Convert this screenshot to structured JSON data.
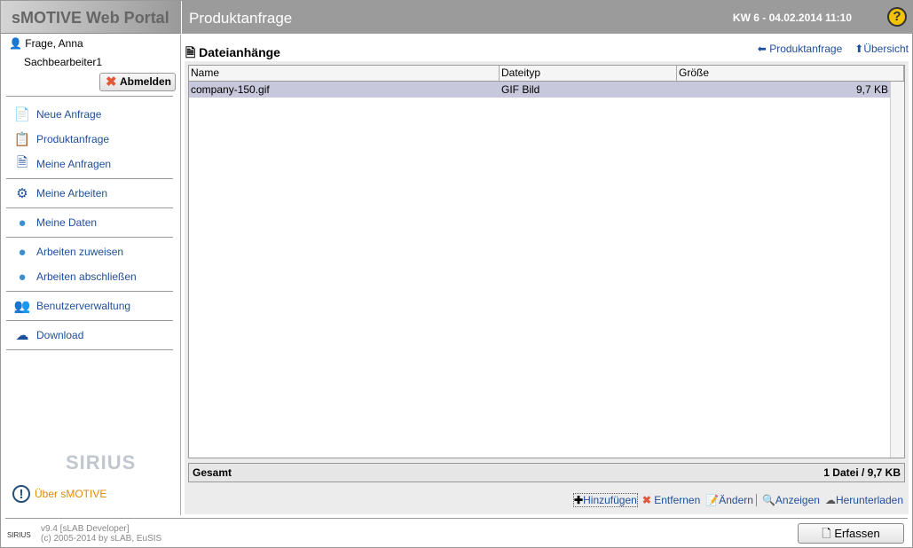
{
  "app": {
    "title": "sMOTIVE Web Portal",
    "page_title": "Produktanfrage",
    "date": "KW 6 - 04.02.2014 11:10"
  },
  "user": {
    "name": "Frage, Anna",
    "role": "Sachbearbeiter1",
    "logout": "Abmelden"
  },
  "nav": [
    {
      "label": "Neue Anfrage",
      "icon": "new-document-icon"
    },
    {
      "label": "Produktanfrage",
      "icon": "product-request-icon"
    },
    {
      "label": "Meine Anfragen",
      "icon": "my-requests-icon"
    },
    {
      "label": "Meine Arbeiten",
      "icon": "gears-icon"
    },
    {
      "label": "Meine Daten",
      "icon": "user-icon"
    },
    {
      "label": "Arbeiten zuweisen",
      "icon": "worker-icon"
    },
    {
      "label": "Arbeiten abschließen",
      "icon": "worker-done-icon"
    },
    {
      "label": "Benutzerverwaltung",
      "icon": "users-icon"
    },
    {
      "label": "Download",
      "icon": "cloud-download-icon"
    }
  ],
  "logo": "SIRIUS",
  "about": "Über sMOTIVE",
  "main": {
    "title": "Dateianhänge",
    "link_back": "Produktanfrage",
    "link_overview": "Übersicht",
    "columns": [
      "Name",
      "Dateityp",
      "Größe"
    ],
    "rows": [
      {
        "name": "company-150.gif",
        "type": "GIF Bild",
        "size": "9,7 KB"
      }
    ],
    "total_label": "Gesamt",
    "total_value": "1 Datei / 9,7 KB",
    "actions": [
      "Hinzufügen",
      "Entfernen",
      "Ändern",
      "Anzeigen",
      "Herunterladen"
    ]
  },
  "footer": {
    "version": "v9.4 [sLAB Developer]",
    "copyright": "(c) 2005-2014 by sLAB, EuSIS",
    "button": "Erfassen"
  }
}
